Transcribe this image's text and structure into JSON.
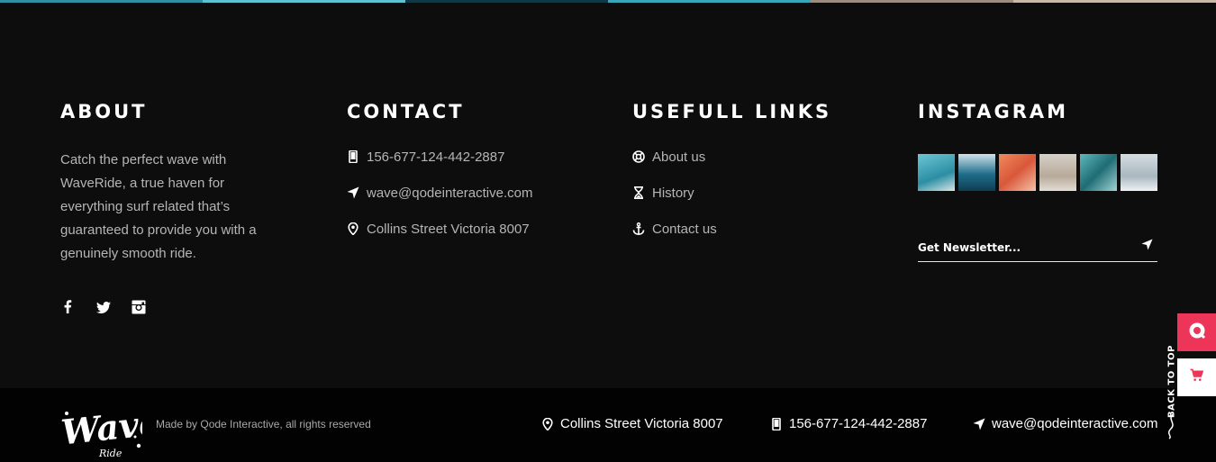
{
  "about": {
    "title": "ABOUT",
    "text": "Catch the perfect wave with WaveRide, a true haven for everything surf related that’s guaranteed to provide you with a genuinely smooth ride.",
    "socials": [
      {
        "icon": "facebook-icon",
        "glyph": "f"
      },
      {
        "icon": "twitter-icon",
        "glyph": "t"
      },
      {
        "icon": "instagram-icon",
        "glyph": "i"
      }
    ]
  },
  "contact": {
    "title": "CONTACT",
    "items": [
      {
        "icon": "phone-icon",
        "label": "156-677-124-442-2887"
      },
      {
        "icon": "send-icon",
        "label": "wave@qodeinteractive.com"
      },
      {
        "icon": "location-pin-icon",
        "label": "Collins Street Victoria 8007"
      }
    ]
  },
  "links": {
    "title": "USEFULL LINKS",
    "items": [
      {
        "icon": "lifebuoy-icon",
        "label": "About us"
      },
      {
        "icon": "hourglass-icon",
        "label": "History"
      },
      {
        "icon": "anchor-icon",
        "label": "Contact us"
      }
    ]
  },
  "instagram": {
    "title": "INSTAGRAM",
    "photos": [
      "#4aa3b5",
      "#1e6d8a",
      "#d9734a",
      "#c9bfb3",
      "#3a8f98",
      "#b8c4cc"
    ],
    "newsletter_placeholder": "Get Newsletter..."
  },
  "bottom": {
    "made_by": "Made by Qode Interactive, all rights reserved",
    "address": "Collins Street Victoria 8007",
    "phone": "156-677-124-442-2887",
    "email": "wave@qodeinteractive.com",
    "logo_text": "Wave",
    "logo_sub": "Ride"
  },
  "side": {
    "back_to_top": "BACK TO TOP"
  },
  "colors": {
    "background": "#0d0d0e",
    "bottom_bar": "#020202",
    "accent": "#ec3558",
    "heading": "#ffffff",
    "text": "#b5b5b5"
  }
}
